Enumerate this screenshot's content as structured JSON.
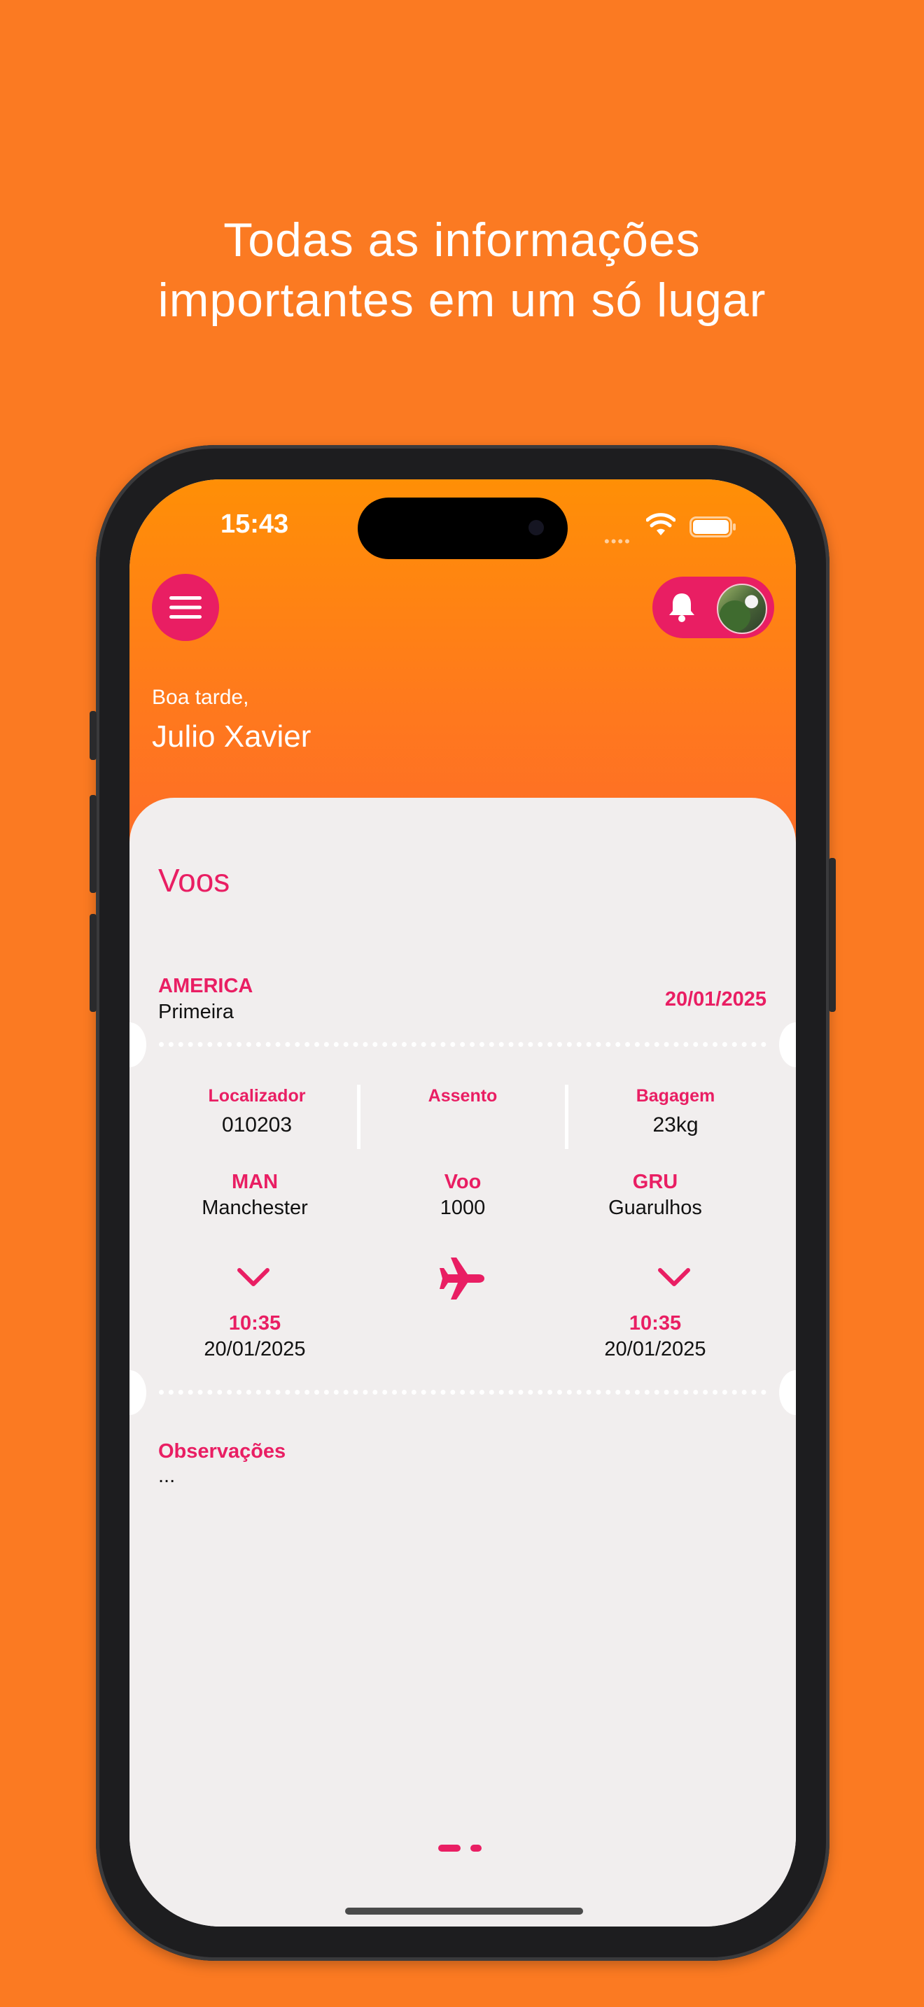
{
  "headline": {
    "line1": "Todas as informações",
    "line2": "importantes em um só lugar"
  },
  "status_bar": {
    "time": "15:43",
    "icons": [
      "cellular-signal-icon",
      "wifi-icon",
      "battery-icon"
    ]
  },
  "header": {
    "menu_icon": "hamburger-menu-icon",
    "notification_icon": "bell-icon",
    "greeting": "Boa tarde,",
    "user_name": "Julio Xavier"
  },
  "flights": {
    "title": "Voos",
    "airline": "AMERICA",
    "class": "Primeira",
    "date": "20/01/2025",
    "localizador": {
      "label": "Localizador",
      "value": "010203"
    },
    "assento": {
      "label": "Assento",
      "value": ""
    },
    "bagagem": {
      "label": "Bagagem",
      "value": "23kg"
    },
    "origin": {
      "code": "MAN",
      "city": "Manchester",
      "time": "10:35",
      "date": "20/01/2025"
    },
    "flight": {
      "label": "Voo",
      "number": "1000"
    },
    "destination": {
      "code": "GRU",
      "city": "Guarulhos",
      "time": "10:35",
      "date": "20/01/2025"
    },
    "observacoes": {
      "label": "Observações",
      "value": "..."
    }
  },
  "pager": {
    "pages": 2,
    "current": 1
  },
  "colors": {
    "background": "#FB7A22",
    "accent": "#E91E63",
    "card": "#F1EEEE",
    "header_top": "#FF8F06",
    "header_bottom": "#FE6B29"
  }
}
